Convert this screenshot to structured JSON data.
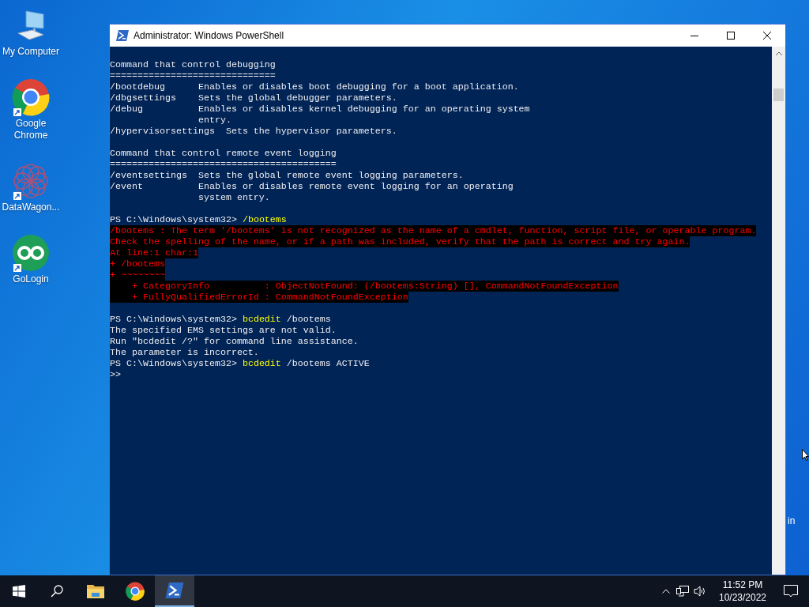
{
  "desktop": {
    "icons": [
      {
        "kind": "computer",
        "label": "My Computer"
      },
      {
        "kind": "chrome",
        "label": "Google Chrome"
      },
      {
        "kind": "datawagon",
        "label": "DataWagon..."
      },
      {
        "kind": "gologin",
        "label": "GoLogin"
      }
    ],
    "edge_text": "in"
  },
  "window": {
    "title": "Administrator: Windows PowerShell",
    "lines": [
      {
        "kind": "blank"
      },
      {
        "kind": "output",
        "text": "Command that control debugging"
      },
      {
        "kind": "output",
        "text": "=============================="
      },
      {
        "kind": "output",
        "text": "/bootdebug      Enables or disables boot debugging for a boot application."
      },
      {
        "kind": "output",
        "text": "/dbgsettings    Sets the global debugger parameters."
      },
      {
        "kind": "output",
        "text": "/debug          Enables or disables kernel debugging for an operating system"
      },
      {
        "kind": "output",
        "text": "                entry."
      },
      {
        "kind": "output",
        "text": "/hypervisorsettings  Sets the hypervisor parameters."
      },
      {
        "kind": "blank"
      },
      {
        "kind": "output",
        "text": "Command that control remote event logging"
      },
      {
        "kind": "output",
        "text": "========================================="
      },
      {
        "kind": "output",
        "text": "/eventsettings  Sets the global remote event logging parameters."
      },
      {
        "kind": "output",
        "text": "/event          Enables or disables remote event logging for an operating"
      },
      {
        "kind": "output",
        "text": "                system entry."
      },
      {
        "kind": "blank"
      },
      {
        "kind": "prompt",
        "prompt": "PS C:\\Windows\\system32> ",
        "command": "/bootems"
      },
      {
        "kind": "error",
        "text": "/bootems : The term '/bootems' is not recognized as the name of a cmdlet, function, script file, or operable program."
      },
      {
        "kind": "error",
        "text": "Check the spelling of the name, or if a path was included, verify that the path is correct and try again."
      },
      {
        "kind": "error",
        "text": "At line:1 char:1"
      },
      {
        "kind": "error",
        "text": "+ /bootems"
      },
      {
        "kind": "error",
        "text": "+ ~~~~~~~~"
      },
      {
        "kind": "error",
        "text": "    + CategoryInfo          : ObjectNotFound: (/bootems:String) [], CommandNotFoundException"
      },
      {
        "kind": "error",
        "text": "    + FullyQualifiedErrorId : CommandNotFoundException"
      },
      {
        "kind": "blank"
      },
      {
        "kind": "prompt",
        "prompt": "PS C:\\Windows\\system32> ",
        "command": "bcdedit",
        "args": " /bootems"
      },
      {
        "kind": "output",
        "text": "The specified EMS settings are not valid."
      },
      {
        "kind": "output",
        "text": "Run \"bcdedit /?\" for command line assistance."
      },
      {
        "kind": "output",
        "text": "The parameter is incorrect."
      },
      {
        "kind": "prompt",
        "prompt": "PS C:\\Windows\\system32> ",
        "command": "bcdedit",
        "args": " /bootems ACTIVE"
      },
      {
        "kind": "output",
        "text": ">>"
      }
    ]
  },
  "taskbar": {
    "apps": [
      {
        "kind": "explorer",
        "selected": false
      },
      {
        "kind": "chrome",
        "selected": false
      },
      {
        "kind": "powershell",
        "selected": true
      }
    ],
    "time": "11:52 PM",
    "date": "10/23/2022"
  }
}
